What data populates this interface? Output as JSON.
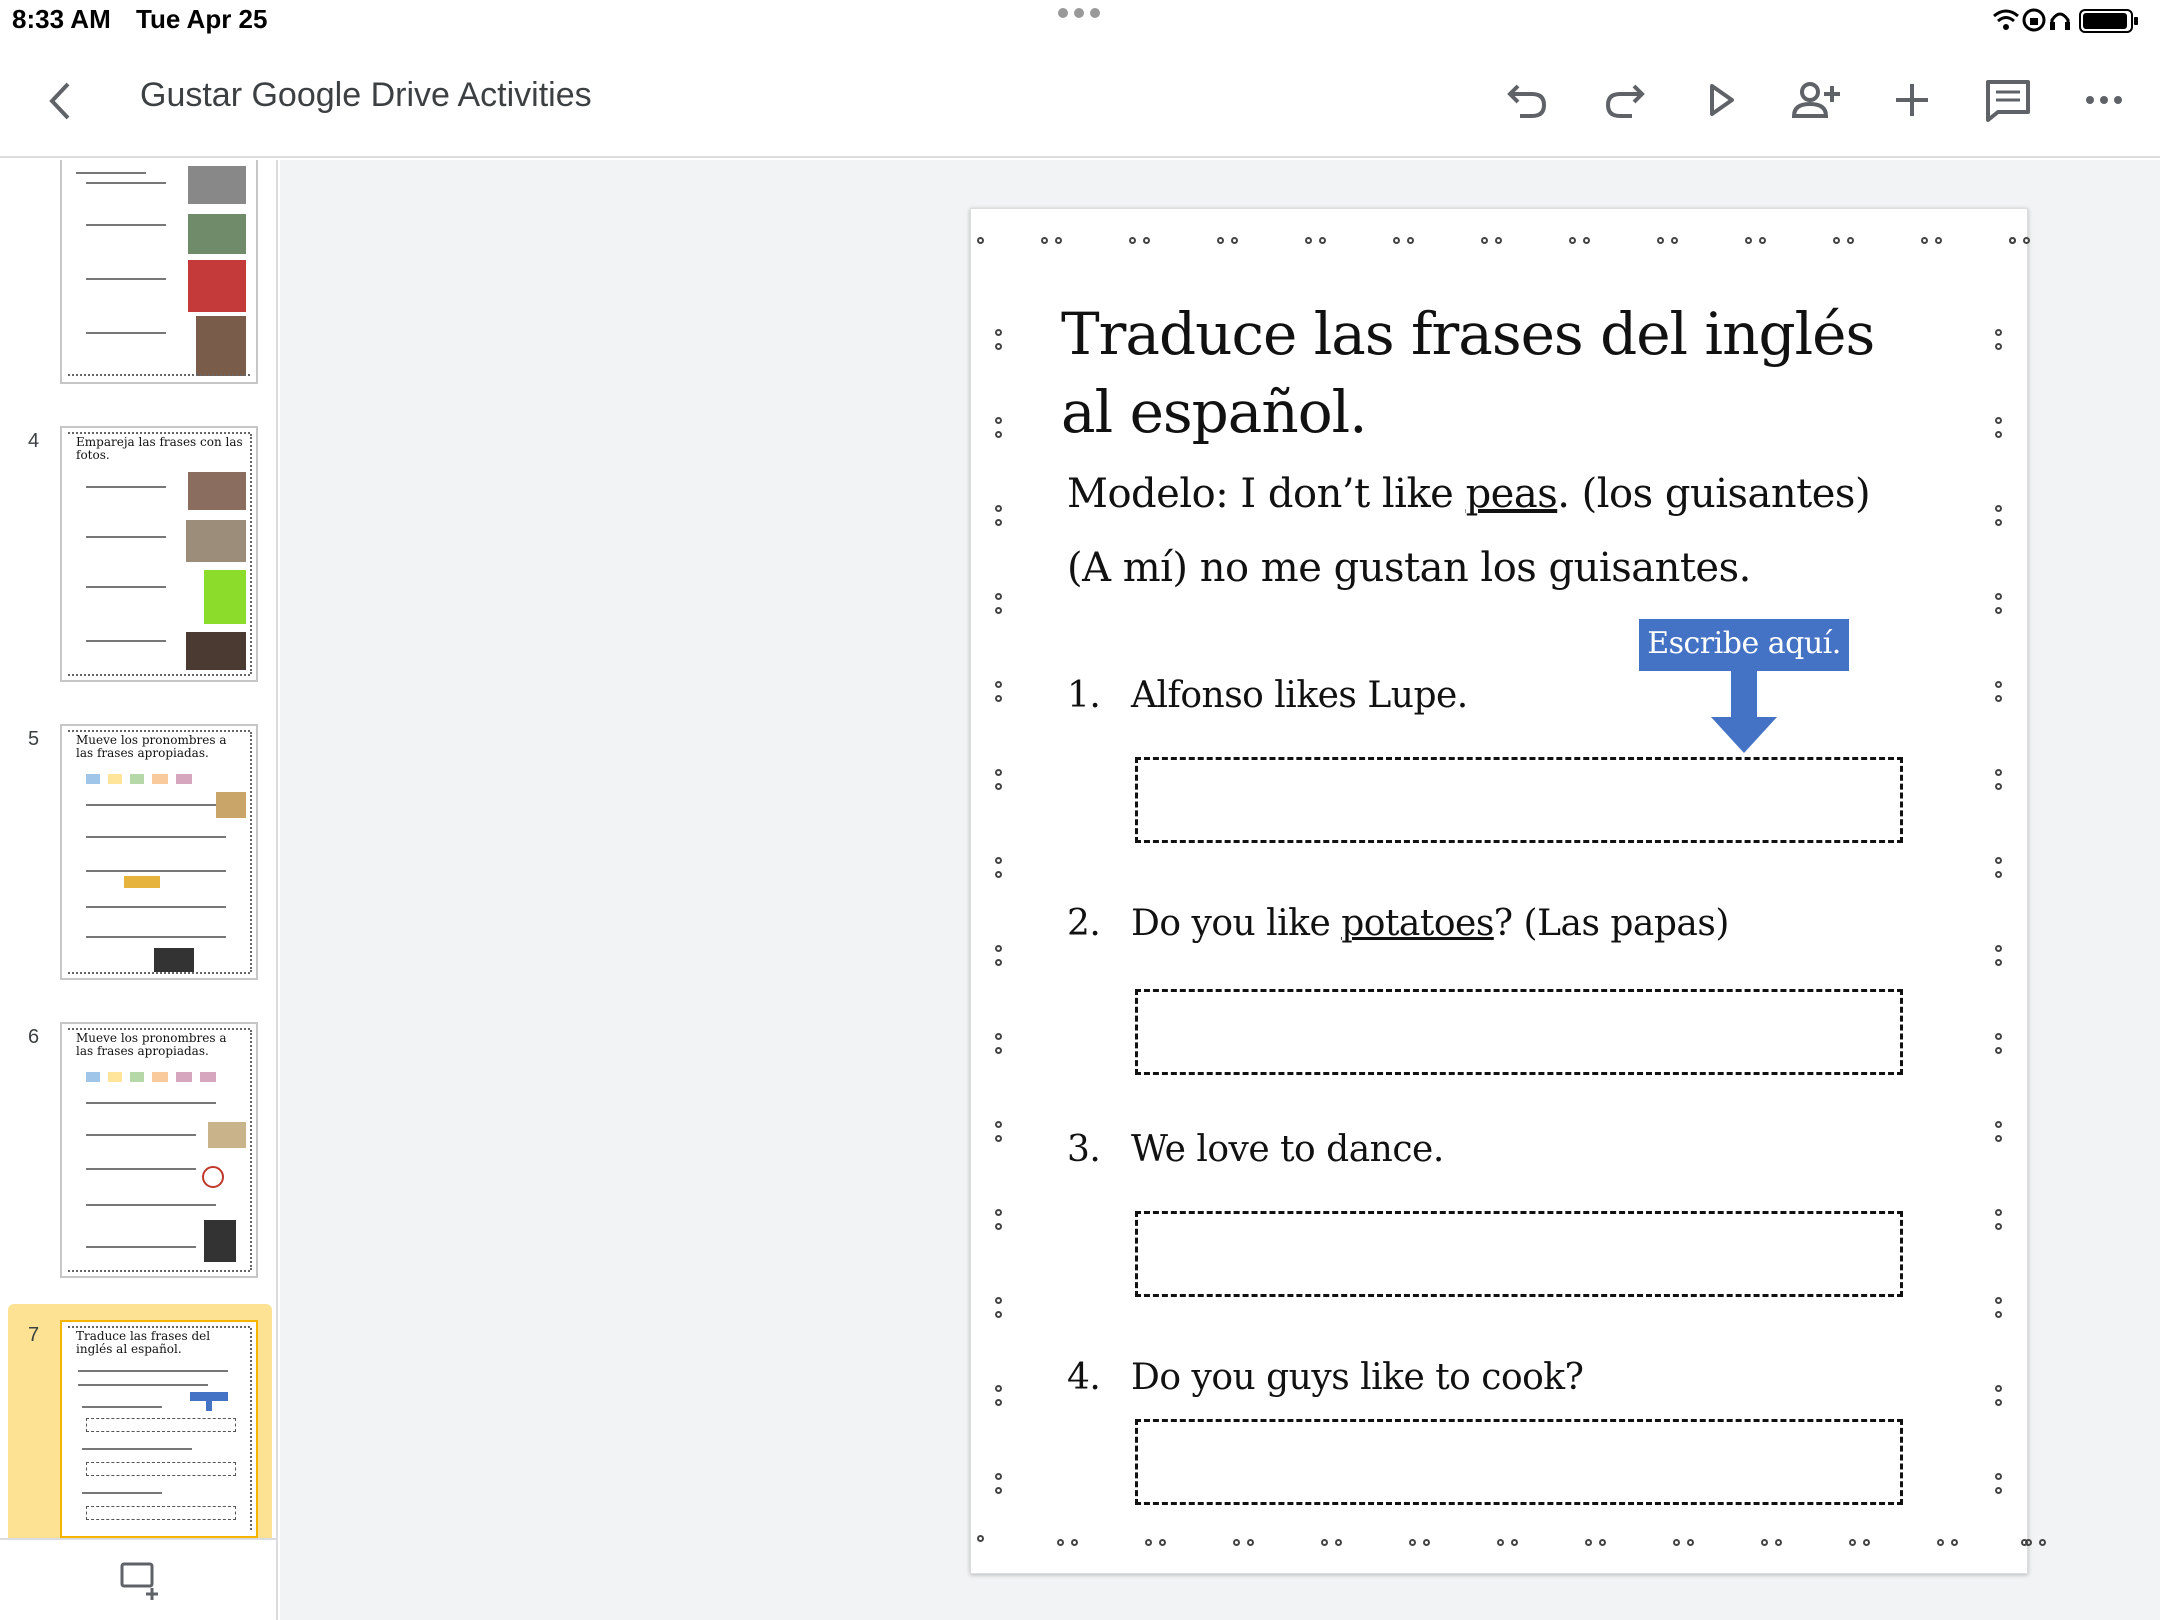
{
  "status_bar": {
    "time": "8:33 AM",
    "date": "Tue Apr 25"
  },
  "app_bar": {
    "title": "Gustar Google Drive Activities",
    "icons": [
      "back-icon",
      "undo-icon",
      "redo-icon",
      "present-icon",
      "share-icon",
      "add-icon",
      "comment-icon",
      "more-icon"
    ]
  },
  "sidebar": {
    "slides": [
      {
        "number": "4",
        "title": "Empareja las frases con las fotos."
      },
      {
        "number": "5",
        "title": "Mueve los pronombres a las frases apropiadas."
      },
      {
        "number": "6",
        "title": "Mueve los pronombres a las frases apropiadas."
      },
      {
        "number": "7",
        "title": "Traduce las frases del inglés al español.",
        "selected": true
      }
    ]
  },
  "slide": {
    "title": "Traduce las frases del inglés al español.",
    "modelo_prefix": "Modelo: I don’t like ",
    "modelo_underlined": "peas",
    "modelo_suffix": ". (los guisantes)",
    "modelo_answer": "(A mí) no me gustan los guisantes.",
    "callout": "Escribe aquí.",
    "questions": [
      {
        "number": "1.",
        "text": "Alfonso likes Lupe."
      },
      {
        "number": "2.",
        "text_prefix": "Do you like ",
        "text_underlined": "potatoes",
        "text_suffix": "? (Las papas)"
      },
      {
        "number": "3.",
        "text": "We love to dance."
      },
      {
        "number": "4.",
        "text": "Do you guys like to cook?"
      }
    ]
  },
  "colors": {
    "accent_blue": "#4472c4",
    "selected_thumb": "#fde293",
    "canvas_bg": "#f1f3f4"
  }
}
